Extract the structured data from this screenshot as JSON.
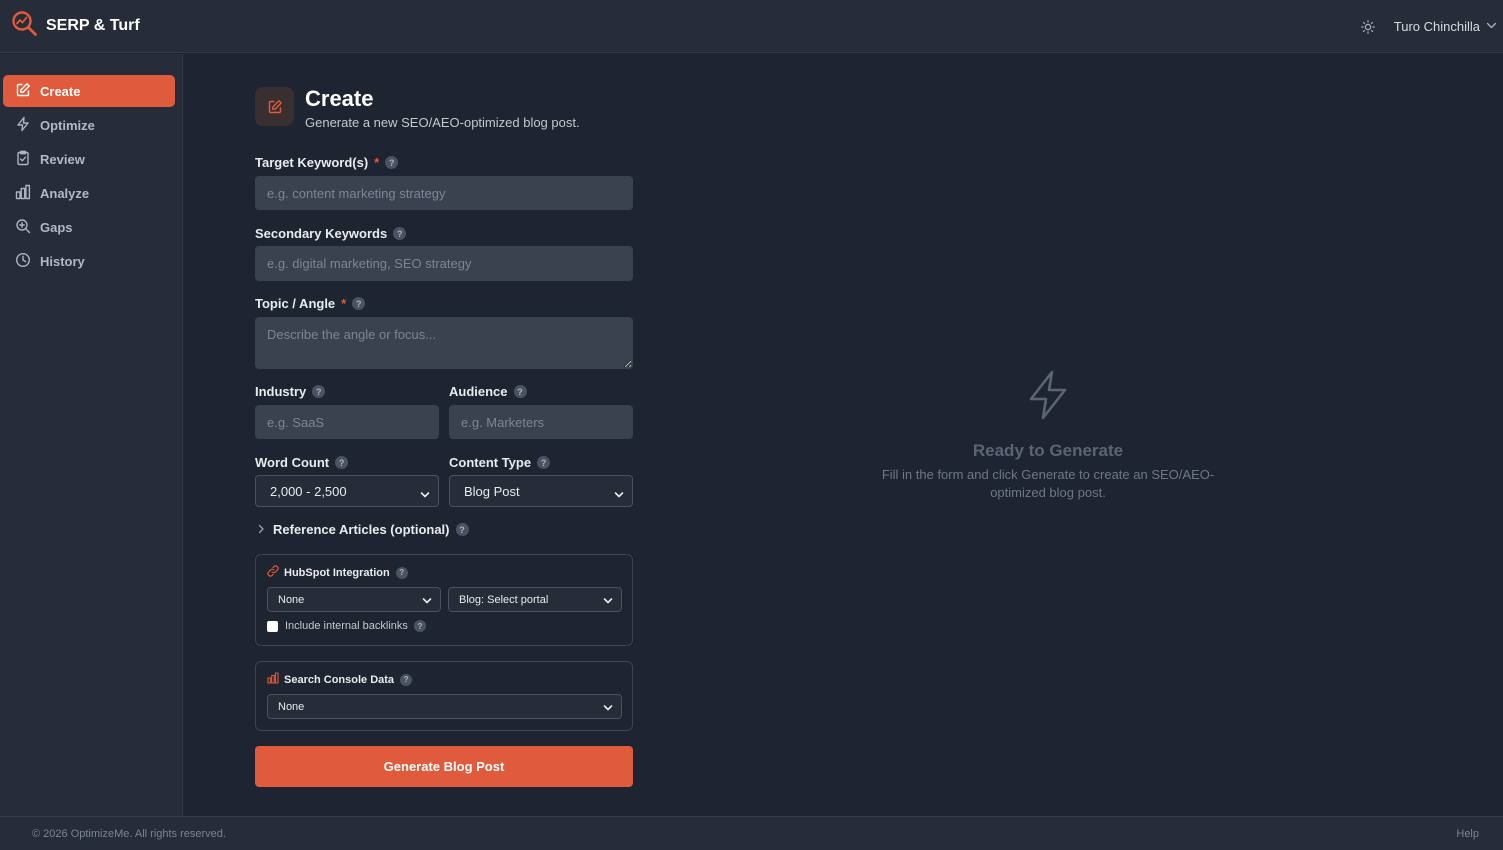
{
  "app": {
    "title": "SERP & Turf"
  },
  "header": {
    "user_name": "Turo Chinchilla"
  },
  "sidebar": {
    "items": [
      {
        "label": "Create",
        "icon": "edit-icon",
        "active": true
      },
      {
        "label": "Optimize",
        "icon": "lightning-icon",
        "active": false
      },
      {
        "label": "Review",
        "icon": "clipboard-check-icon",
        "active": false
      },
      {
        "label": "Analyze",
        "icon": "bar-chart-icon",
        "active": false
      },
      {
        "label": "Gaps",
        "icon": "zoom-in-icon",
        "active": false
      },
      {
        "label": "History",
        "icon": "clock-icon",
        "active": false
      }
    ]
  },
  "page": {
    "title": "Create",
    "subtitle": "Generate a new SEO/AEO-optimized blog post."
  },
  "form": {
    "target_keywords": {
      "label": "Target Keyword(s)",
      "required": "*",
      "placeholder": "e.g. content marketing strategy",
      "value": ""
    },
    "secondary_keywords": {
      "label": "Secondary Keywords",
      "placeholder": "e.g. digital marketing, SEO strategy",
      "value": ""
    },
    "topic": {
      "label": "Topic / Angle",
      "required": "*",
      "placeholder": "Describe the angle or focus...",
      "value": ""
    },
    "industry": {
      "label": "Industry",
      "placeholder": "e.g. SaaS",
      "value": ""
    },
    "audience": {
      "label": "Audience",
      "placeholder": "e.g. Marketers",
      "value": ""
    },
    "word_count": {
      "label": "Word Count",
      "selected": "2,000 - 2,500"
    },
    "content_type": {
      "label": "Content Type",
      "selected": "Blog Post"
    },
    "reference_articles": {
      "label": "Reference Articles (optional)"
    },
    "hubspot": {
      "title": "HubSpot Integration",
      "connection_selected": "None",
      "blog_selected": "Blog: Select portal",
      "backlinks_label": "Include internal backlinks",
      "backlinks_checked": false
    },
    "search_console": {
      "title": "Search Console Data",
      "selected": "None"
    },
    "help_glyph": "?",
    "submit_label": "Generate Blog Post"
  },
  "empty_state": {
    "title": "Ready to Generate",
    "description": "Fill in the form and click Generate to create an SEO/AEO-optimized blog post."
  },
  "footer": {
    "copyright": "© 2026 OptimizeMe. All rights reserved.",
    "help_link": "Help"
  },
  "colors": {
    "accent": "#e05a3c",
    "background": "#1e2430",
    "surface": "#262c38",
    "input": "#3a414f"
  }
}
